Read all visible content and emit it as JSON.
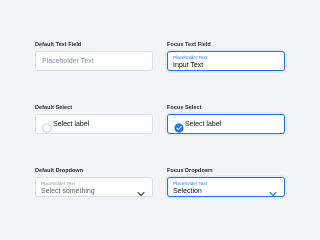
{
  "colors": {
    "accent": "#1e78e6",
    "text": "#12141a",
    "muted": "#8d929b",
    "border": "#dcdfe4"
  },
  "text_field": {
    "default_label": "Default Text Field",
    "default_placeholder": "Placeholder Text",
    "focus_label": "Focus Text Field",
    "focus_floating_label": "Placeholder Text",
    "focus_value": "Input Text"
  },
  "select": {
    "default_label": "Default Select",
    "default_text": "Select label",
    "default_icon": "radio-unchecked-icon",
    "focus_label": "Focus Select",
    "focus_text": "Select label",
    "focus_icon": "check-circle-icon"
  },
  "dropdown": {
    "default_label": "Default Dropdown",
    "default_floating_label": "Placeholder Text",
    "default_value": "Select something",
    "focus_label": "Focus Dropdown",
    "focus_floating_label": "Placeholder Text",
    "focus_value": "Selection",
    "icon": "chevron-down-icon"
  }
}
